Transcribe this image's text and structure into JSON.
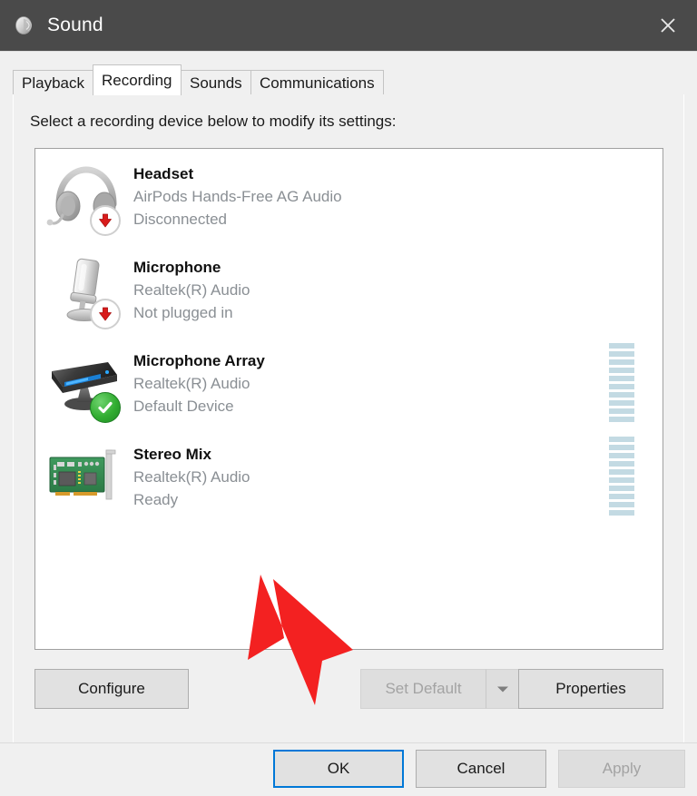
{
  "window": {
    "title": "Sound",
    "app_icon": "speaker-icon",
    "close_label": "✕",
    "titlebar_color": "#4a4a4a"
  },
  "tabs": [
    {
      "label": "Playback",
      "selected": false
    },
    {
      "label": "Recording",
      "selected": true
    },
    {
      "label": "Sounds",
      "selected": false
    },
    {
      "label": "Communications",
      "selected": false
    }
  ],
  "panel": {
    "instruction": "Select a recording device below to modify its settings:"
  },
  "devices": [
    {
      "name": "Headset",
      "driver": "AirPods Hands-Free AG Audio",
      "status": "Disconnected",
      "icon": "headset-icon",
      "badge": "red-down-arrow-badge",
      "meter_segments": 0,
      "meter_filled": 0
    },
    {
      "name": "Microphone",
      "driver": "Realtek(R) Audio",
      "status": "Not plugged in",
      "icon": "microphone-icon",
      "badge": "red-down-arrow-badge",
      "meter_segments": 0,
      "meter_filled": 0
    },
    {
      "name": "Microphone Array",
      "driver": "Realtek(R) Audio",
      "status": "Default Device",
      "icon": "microphone-array-icon",
      "badge": "green-check-badge",
      "meter_segments": 10,
      "meter_filled": 0
    },
    {
      "name": "Stereo Mix",
      "driver": "Realtek(R) Audio",
      "status": "Ready",
      "icon": "sound-card-icon",
      "badge": "none",
      "meter_segments": 10,
      "meter_filled": 0
    }
  ],
  "buttons": {
    "configure": "Configure",
    "set_default": "Set Default",
    "set_default_disabled": true,
    "set_default_arrow": "▼",
    "properties": "Properties",
    "ok": "OK",
    "cancel": "Cancel",
    "apply": "Apply",
    "apply_disabled": true
  },
  "annotation": {
    "type": "red-arrow",
    "color": "#f32121",
    "points_to": "ok-button"
  },
  "colors": {
    "accent": "#0078d7",
    "meter_segment": "#c3dae3",
    "disabled_text": "#a3a3a3",
    "secondary_text": "#8a8f94",
    "annotation_red": "#f32121"
  }
}
